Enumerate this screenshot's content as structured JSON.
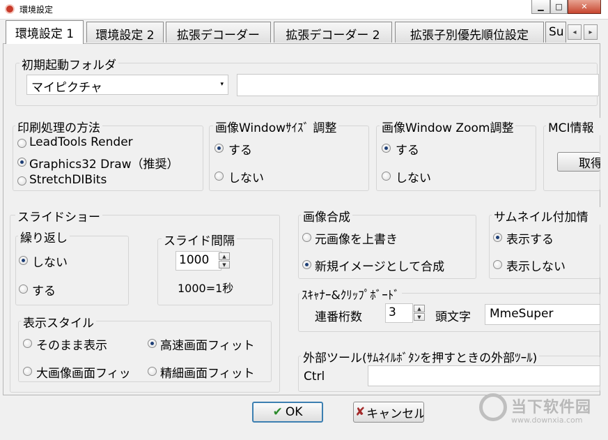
{
  "window": {
    "title": "環境設定",
    "minimize_icon": "minimize-icon",
    "maximize_icon": "maximize-icon",
    "close_icon": "close-icon"
  },
  "tabs": [
    {
      "label": "環境設定 1",
      "active": true
    },
    {
      "label": "環境設定 2"
    },
    {
      "label": "拡張デコーダー"
    },
    {
      "label": "拡張デコーダー 2"
    },
    {
      "label": "拡張子別優先順位設定"
    },
    {
      "label": "Su"
    }
  ],
  "tab_scroll": {
    "left": "◂",
    "right": "▸"
  },
  "startup_folder": {
    "label": "初期起動フォルダ",
    "selected": "マイピクチャ",
    "arrow": "▾",
    "path_value": ""
  },
  "print_method": {
    "label": "印刷処理の方法",
    "options": [
      {
        "label": "LeadTools Render",
        "checked": false
      },
      {
        "label": "Graphics32 Draw（推奨）",
        "checked": true
      },
      {
        "label": "StretchDIBits",
        "checked": false
      }
    ]
  },
  "window_size": {
    "label": "画像Windowｻｲｽﾞ 調整",
    "options": [
      {
        "label": "する",
        "checked": true
      },
      {
        "label": "しない",
        "checked": false
      }
    ]
  },
  "window_zoom": {
    "label": "画像Window Zoom調整",
    "options": [
      {
        "label": "する",
        "checked": true
      },
      {
        "label": "しない",
        "checked": false
      }
    ]
  },
  "mci_info": {
    "label": "MCI情報",
    "button": "取得"
  },
  "slideshow": {
    "label": "スライドショー",
    "repeat": {
      "label": "繰り返し",
      "options": [
        {
          "label": "しない",
          "checked": true
        },
        {
          "label": "する",
          "checked": false
        }
      ]
    },
    "interval": {
      "label": "スライド間隔",
      "value": "1000",
      "note": "1000=1秒"
    },
    "display_style": {
      "label": "表示スタイル",
      "options": [
        {
          "label": "そのまま表示",
          "checked": false
        },
        {
          "label": "高速画面フィット",
          "checked": true
        },
        {
          "label": "大画像画面フィッ",
          "checked": false
        },
        {
          "label": "精細画面フィット",
          "checked": false
        }
      ]
    }
  },
  "image_compose": {
    "label": "画像合成",
    "options": [
      {
        "label": "元画像を上書き",
        "checked": false
      },
      {
        "label": "新規イメージとして合成",
        "checked": true
      }
    ]
  },
  "thumbnail_info": {
    "label": "サムネイル付加情",
    "options": [
      {
        "label": "表示する",
        "checked": true
      },
      {
        "label": "表示しない",
        "checked": false
      }
    ]
  },
  "scanner": {
    "label": "ｽｷｬﾅｰ&ｸﾘｯﾌﾟﾎﾞｰﾄﾞ",
    "serial_label": "連番桁数",
    "serial_value": "3",
    "prefix_label": "頭文字",
    "prefix_value": "MmeSuper"
  },
  "external_tool": {
    "label": "外部ツール(ｻﾑﾈｲﾙﾎﾞﾀﾝを押すときの外部ﾂｰﾙ)",
    "ctrl_label": "Ctrl",
    "ctrl_value": ""
  },
  "buttons": {
    "ok": "OK",
    "ok_icon": "✔",
    "cancel": "キャンセル",
    "cancel_icon": "✘"
  },
  "spin": {
    "up": "▲",
    "down": "▼"
  },
  "watermark": {
    "text": "当下软件园",
    "url": "www.downxia.com"
  }
}
